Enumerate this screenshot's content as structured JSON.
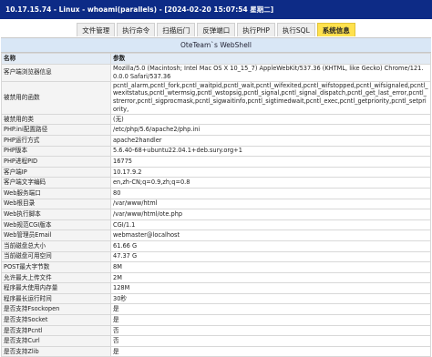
{
  "header": {
    "title": "10.17.15.74 - Linux - whoami(parallels) - [2024-02-20 15:07:54 星期二]"
  },
  "tabs": [
    {
      "label": "文件管理",
      "active": false
    },
    {
      "label": "执行命令",
      "active": false
    },
    {
      "label": "扫描后门",
      "active": false
    },
    {
      "label": "反弹端口",
      "active": false
    },
    {
      "label": "执行PHP",
      "active": false
    },
    {
      "label": "执行SQL",
      "active": false
    },
    {
      "label": "系统信息",
      "active": true
    }
  ],
  "panel": {
    "title": "OteTeam`s WebShell",
    "columns": {
      "name": "名称",
      "value": "参数"
    },
    "rows": [
      {
        "name": "客户端浏览器信息",
        "value": "Mozilla/5.0 (Macintosh; Intel Mac OS X 10_15_7) AppleWebKit/537.36 (KHTML, like Gecko) Chrome/121.0.0.0 Safari/537.36"
      },
      {
        "name": "被禁用的函数",
        "value": "pcntl_alarm,pcntl_fork,pcntl_waitpid,pcntl_wait,pcntl_wifexited,pcntl_wifstopped,pcntl_wifsignaled,pcntl_wexitstatus,pcntl_wtermsig,pcntl_wstopsig,pcntl_signal,pcntl_signal_dispatch,pcntl_get_last_error,pcntl_strerror,pcntl_sigprocmask,pcntl_sigwaitinfo,pcntl_sigtimedwait,pcntl_exec,pcntl_getpriority,pcntl_setpriority,"
      },
      {
        "name": "被禁用的类",
        "value": "(无)"
      },
      {
        "name": "PHP.ini配置路径",
        "value": "/etc/php/5.6/apache2/php.ini"
      },
      {
        "name": "PHP运行方式",
        "value": "apache2handler"
      },
      {
        "name": "PHP版本",
        "value": "5.6.40-68+ubuntu22.04.1+deb.sury.org+1"
      },
      {
        "name": "PHP进程PID",
        "value": "16775"
      },
      {
        "name": "客户端IP",
        "value": "10.17.9.2"
      },
      {
        "name": "客户端文字编码",
        "value": "en,zh-CN;q=0.9,zh;q=0.8"
      },
      {
        "name": "Web服务端口",
        "value": "80"
      },
      {
        "name": "Web根目录",
        "value": "/var/www/html"
      },
      {
        "name": "Web执行脚本",
        "value": "/var/www/html/ote.php"
      },
      {
        "name": "Web规范CGI版本",
        "value": "CGI/1.1"
      },
      {
        "name": "Web管理员Email",
        "value": "webmaster@localhost"
      },
      {
        "name": "当前磁盘总大小",
        "value": "61.66 G"
      },
      {
        "name": "当前磁盘可用空间",
        "value": "47.37 G"
      },
      {
        "name": "POST最大字节数",
        "value": "8M"
      },
      {
        "name": "允许最大上传文件",
        "value": "2M"
      },
      {
        "name": "程序最大使用内存量",
        "value": "128M"
      },
      {
        "name": "程序最长运行时间",
        "value": "30秒"
      },
      {
        "name": "是否支持Fsockopen",
        "value": "是"
      },
      {
        "name": "是否支持Socket",
        "value": "是"
      },
      {
        "name": "是否支持Pcntl",
        "value": "否"
      },
      {
        "name": "是否支持Curl",
        "value": "否"
      },
      {
        "name": "是否支持Zlib",
        "value": "是"
      }
    ]
  },
  "colors": {
    "header_bg": "#0d2b86",
    "active_tab": "#ffe14d",
    "panel_title_bg": "#d9e7f6"
  }
}
